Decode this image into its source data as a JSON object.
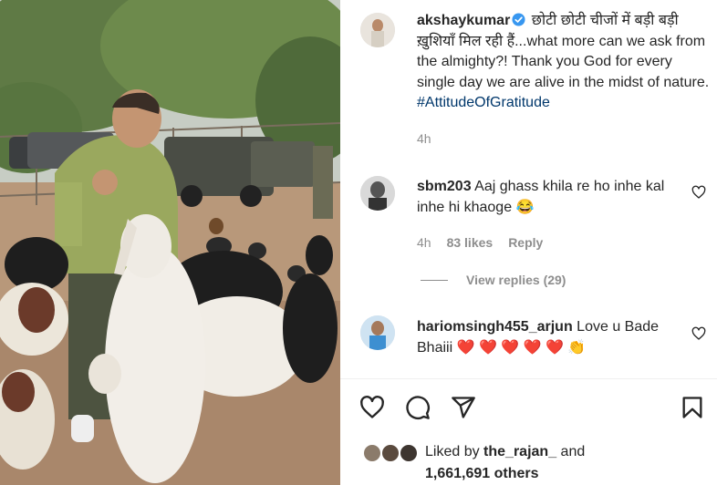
{
  "post": {
    "username": "akshaykumar",
    "caption_text": "छोटी छोटी चीजों में बड़ी बड़ी ख़ुशियाँ मिल रही हैं...what more can we ask from the almighty?! Thank you God for every single day we are alive in the midst of nature.",
    "hashtag": "#AttitudeOfGratitude",
    "time": "4h"
  },
  "comments": [
    {
      "username": "sbm203",
      "text": "Aaj ghass khila re ho inhe kal inhe hi khaoge",
      "emoji": "😂",
      "time": "4h",
      "likes": "83 likes",
      "reply_label": "Reply",
      "view_replies": "View replies (29)"
    },
    {
      "username": "hariomsingh455_arjun",
      "text": "Love u Bade Bhaiii",
      "emoji": "❤️ ❤️ ❤️ ❤️ ❤️ 👏"
    }
  ],
  "likes": {
    "prefix": "Liked by",
    "user": "the_rajan_",
    "conjunction": "and",
    "others": "1,661,691 others"
  },
  "icons": {
    "like": "heart-icon",
    "comment": "comment-icon",
    "share": "share-icon",
    "save": "bookmark-icon",
    "verified": "verified-badge-icon"
  },
  "colors": {
    "verified": "#3897f0",
    "hashtag": "#00376b",
    "secondary_text": "#8e8e8e"
  }
}
